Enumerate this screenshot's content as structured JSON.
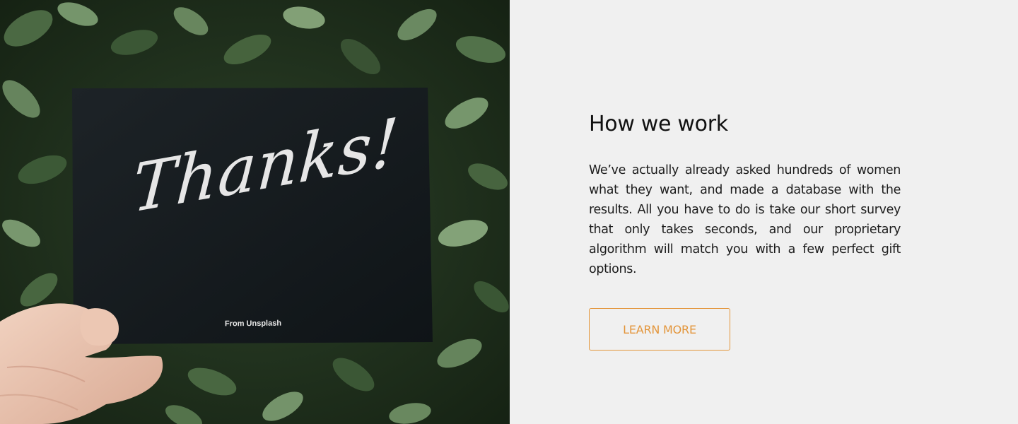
{
  "photo": {
    "card_script": "Thanks!",
    "card_credit": "From Unsplash",
    "colors": {
      "foliage_dark": "#1c2a1a",
      "foliage_mid": "#3d5a36",
      "foliage_light": "#7a9a70",
      "card": "#151b1f",
      "skin": "#e9c2ad"
    }
  },
  "content": {
    "heading": "How we work",
    "body": "We’ve actually already asked hundreds of women what they want, and made a database with the results. All you have to do is take our short survey that only takes seconds, and our proprietary algorithm will match you with a few perfect gift options.",
    "button_label": "LEARN MORE",
    "colors": {
      "background": "#f0f0f0",
      "text": "#111111",
      "accent": "#e3953a"
    }
  }
}
